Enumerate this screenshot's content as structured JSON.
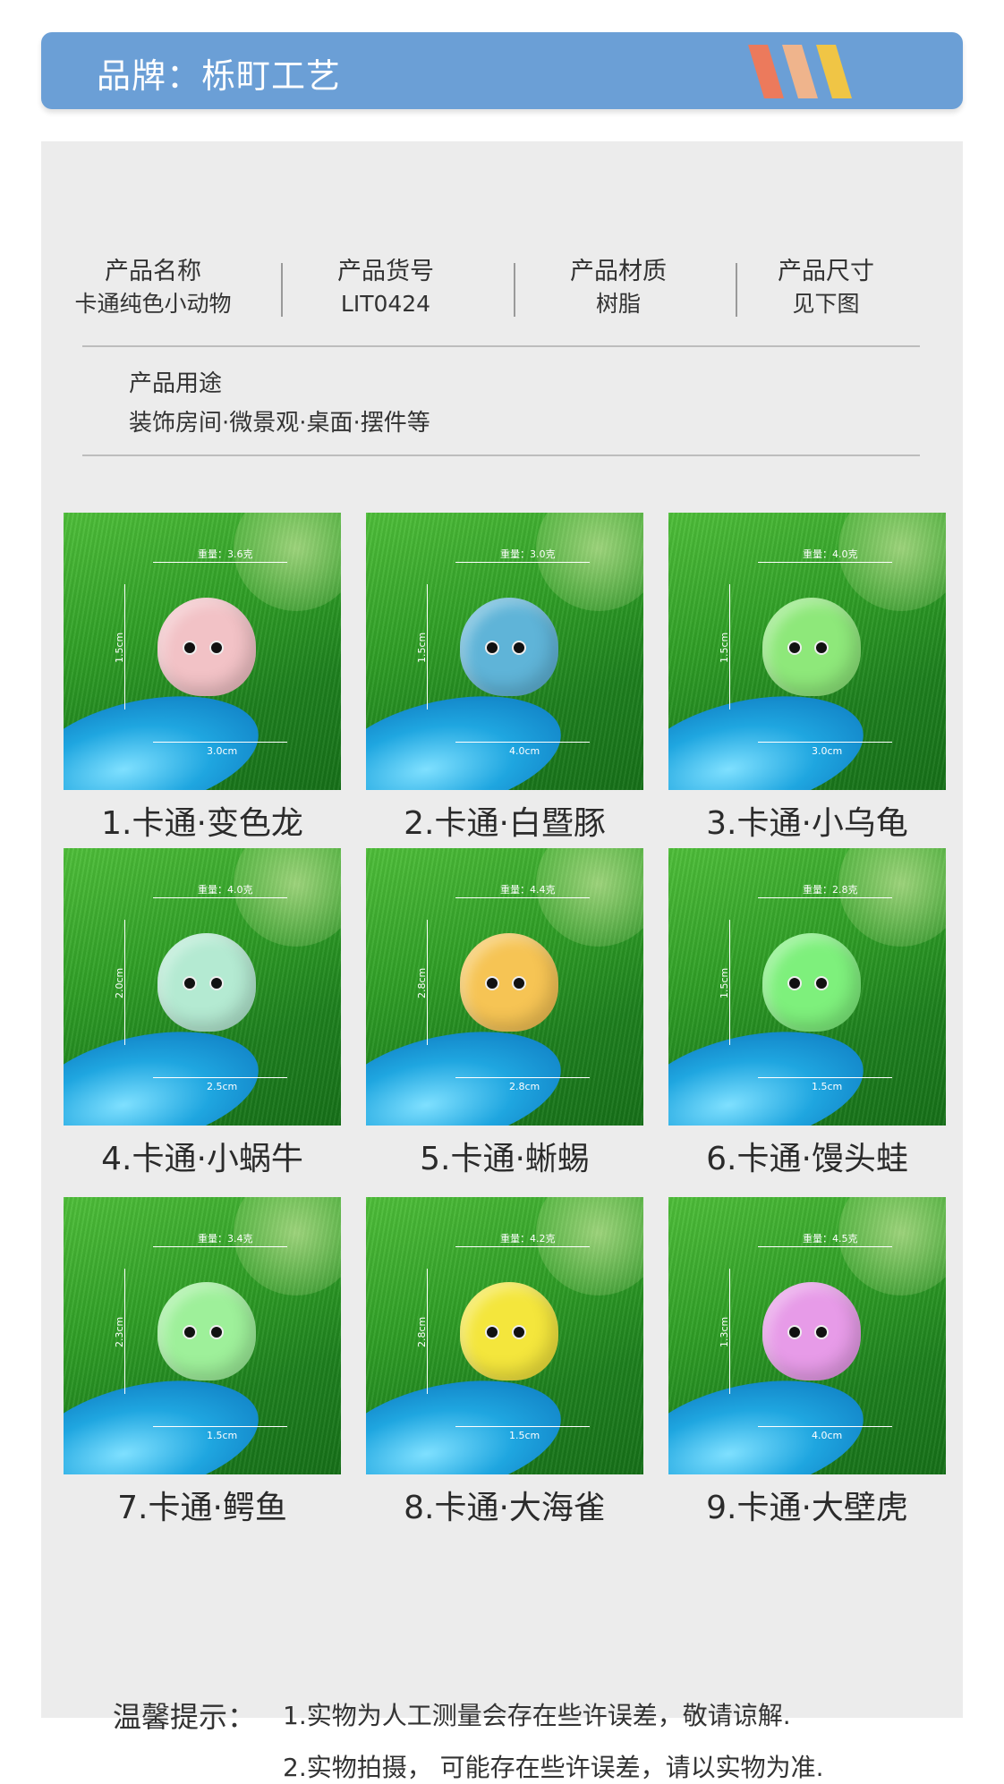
{
  "banner": {
    "title": "品牌：栎町工艺"
  },
  "info": {
    "name_label": "产品名称",
    "name_value": "卡通纯色小动物",
    "sku_label": "产品货号",
    "sku_value": "LIT0424",
    "material_label": "产品材质",
    "material_value": "树脂",
    "size_label": "产品尺寸",
    "size_value": "见下图",
    "usage_label": "产品用途",
    "usage_value": "装饰房间·微景观·桌面·摆件等"
  },
  "products": [
    {
      "caption": "1.卡通·变色龙",
      "weight": "重量：3.6克",
      "height": "1.5cm",
      "width": "3.0cm",
      "color": "#f2c2c6"
    },
    {
      "caption": "2.卡通·白暨豚",
      "weight": "重量：3.0克",
      "height": "1.5cm",
      "width": "4.0cm",
      "color": "#5fb4d8"
    },
    {
      "caption": "3.卡通·小乌龟",
      "weight": "重量：4.0克",
      "height": "1.5cm",
      "width": "3.0cm",
      "color": "#8ee87a"
    },
    {
      "caption": "4.卡通·小蜗牛",
      "weight": "重量：4.0克",
      "height": "2.0cm",
      "width": "2.5cm",
      "color": "#b4ead2"
    },
    {
      "caption": "5.卡通·蜥蜴",
      "weight": "重量：4.4克",
      "height": "2.8cm",
      "width": "2.8cm",
      "color": "#f6c454"
    },
    {
      "caption": "6.卡通·馒头蛙",
      "weight": "重量：2.8克",
      "height": "1.5cm",
      "width": "1.5cm",
      "color": "#7ef07c"
    },
    {
      "caption": "7.卡通·鳄鱼",
      "weight": "重量：3.4克",
      "height": "2.3cm",
      "width": "1.5cm",
      "color": "#9ef09a"
    },
    {
      "caption": "8.卡通·大海雀",
      "weight": "重量：4.2克",
      "height": "2.8cm",
      "width": "1.5cm",
      "color": "#f4e63c"
    },
    {
      "caption": "9.卡通·大壁虎",
      "weight": "重量：4.5克",
      "height": "1.3cm",
      "width": "4.0cm",
      "color": "#e79be8"
    }
  ],
  "tips": {
    "label": "温馨提示：",
    "line1": "1.实物为人工测量会存在些许误差，敬请谅解.",
    "line2": "2.实物拍摄，  可能存在些许误差，请以实物为准."
  },
  "colors": {
    "banner": "#6b9fd6",
    "panel": "#ececec",
    "stripe1": "#ec7a5c",
    "stripe2": "#efb48c",
    "stripe3": "#f0c545"
  }
}
